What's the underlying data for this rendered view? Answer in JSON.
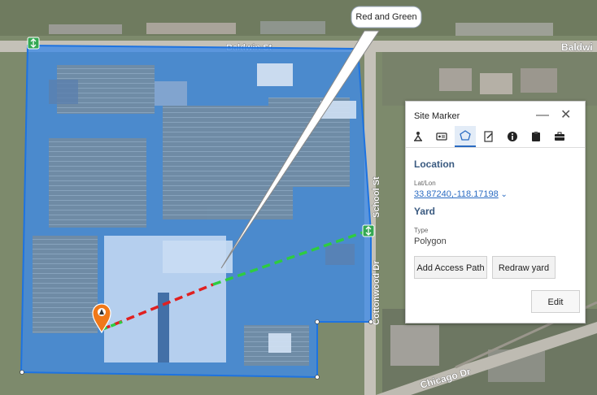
{
  "map": {
    "roads": [
      "Baldwin St",
      "Baldwi",
      "Cottonwood Dr",
      "School St",
      "Chicago Dr"
    ]
  },
  "callout": {
    "text": "Red and Green"
  },
  "panel": {
    "title": "Site Marker",
    "minimize_icon": "minimize-icon",
    "close_icon": "close-icon",
    "tabs": [
      {
        "icon": "hiker-icon",
        "active": false
      },
      {
        "icon": "id-card-icon",
        "active": false
      },
      {
        "icon": "polygon-icon",
        "active": true
      },
      {
        "icon": "edit-document-icon",
        "active": false
      },
      {
        "icon": "info-icon",
        "active": false
      },
      {
        "icon": "clipboard-icon",
        "active": false
      },
      {
        "icon": "briefcase-icon",
        "active": false
      }
    ],
    "location_heading": "Location",
    "latlon_label": "Lat/Lon",
    "latlon_value": "33.87240,-118.17198",
    "yard_heading": "Yard",
    "type_label": "Type",
    "type_value": "Polygon",
    "add_access_path": "Add Access Path",
    "redraw_yard": "Redraw yard",
    "edit": "Edit"
  },
  "colors": {
    "polygon_fill": "#3d8be8",
    "polygon_stroke": "#1e73e0",
    "path_red": "#e02020",
    "path_green": "#2ecc40",
    "marker": "#f07818",
    "access_marker": "#34a853"
  }
}
